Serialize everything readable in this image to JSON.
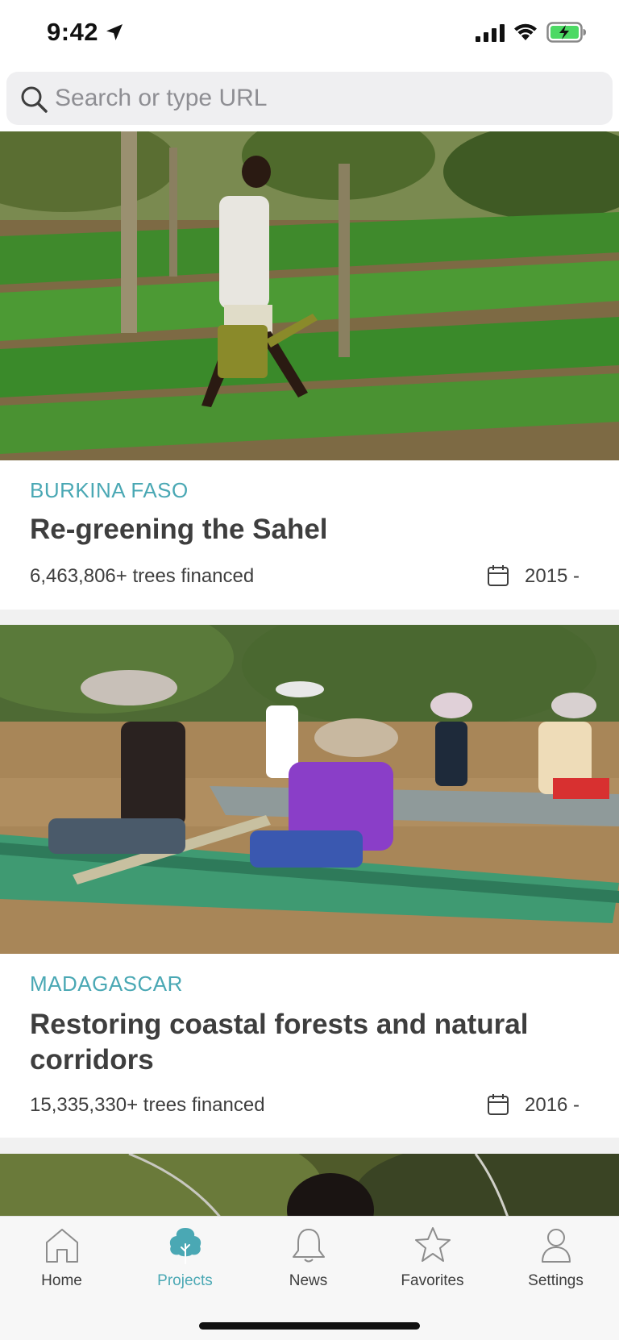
{
  "status_bar": {
    "time": "9:42"
  },
  "search": {
    "placeholder": "Search or type URL"
  },
  "projects": [
    {
      "country": "BURKINA FASO",
      "title": "Re-greening the Sahel",
      "trees": "6,463,806+ trees financed",
      "year": "2015 -"
    },
    {
      "country": "MADAGASCAR",
      "title": "Restoring coastal forests and natural corridors",
      "trees": "15,335,330+ trees financed",
      "year": "2016 -"
    }
  ],
  "tabs": [
    {
      "label": "Home",
      "icon": "house-icon"
    },
    {
      "label": "Projects",
      "icon": "tree-icon"
    },
    {
      "label": "News",
      "icon": "bell-icon"
    },
    {
      "label": "Favorites",
      "icon": "star-icon"
    },
    {
      "label": "Settings",
      "icon": "person-icon"
    }
  ],
  "colors": {
    "accent": "#4aa8b4",
    "text": "#3e3e3e",
    "inactive_icon": "#8d8d8d"
  }
}
